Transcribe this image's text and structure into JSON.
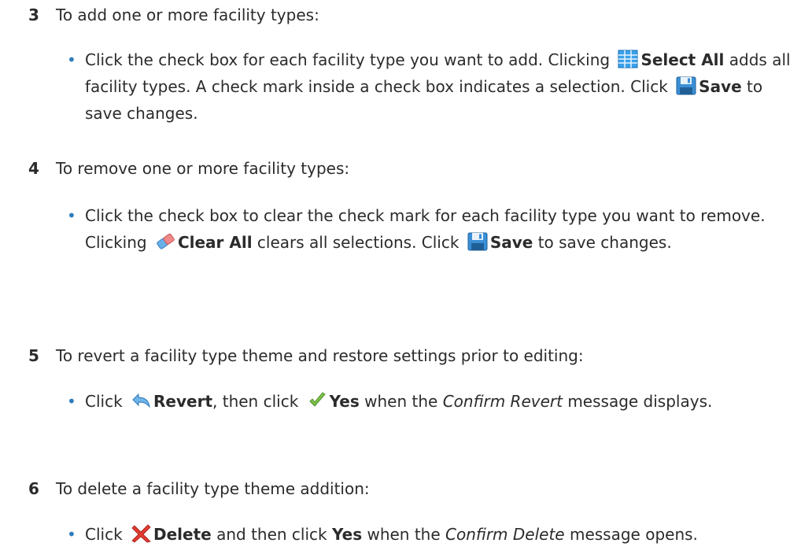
{
  "steps": [
    {
      "number": "3",
      "heading": "To add one or more facility types:",
      "bullet": {
        "part1": "Click the check box for each facility type you want to add. Clicking",
        "select_all": "Select All",
        "part2": "adds all facility types. A check mark inside a check box indicates a selection. Click",
        "save": "Save",
        "part3": "to save changes."
      }
    },
    {
      "number": "4",
      "heading": "To remove one or more facility types:",
      "bullet": {
        "part1": "Click the check box to clear the check mark for each facility type you want to remove. Clicking",
        "clear_all": "Clear All",
        "part2": "clears all selections. Click",
        "save": "Save",
        "part3": "to save changes."
      }
    },
    {
      "number": "5",
      "heading": "To revert a facility type theme and restore settings prior to editing:",
      "bullet": {
        "part1": "Click",
        "revert": "Revert",
        "part2": ", then click",
        "yes": "Yes",
        "part3": "when the",
        "dialog": "Confirm Revert",
        "part4": "message displays."
      }
    },
    {
      "number": "6",
      "heading": "To delete a facility type theme addition:",
      "bullet": {
        "part1": "Click",
        "delete": "Delete",
        "part2": "and then click",
        "yes": "Yes",
        "part3": "when the",
        "dialog": "Confirm Delete",
        "part4": "message opens."
      }
    }
  ],
  "bullet_char": "•",
  "icons": {
    "select_all": "grid-table-icon",
    "save": "floppy-disk-icon",
    "clear_all": "eraser-icon",
    "revert": "revert-arrow-icon",
    "yes": "checkmark-icon",
    "delete": "red-x-icon"
  }
}
